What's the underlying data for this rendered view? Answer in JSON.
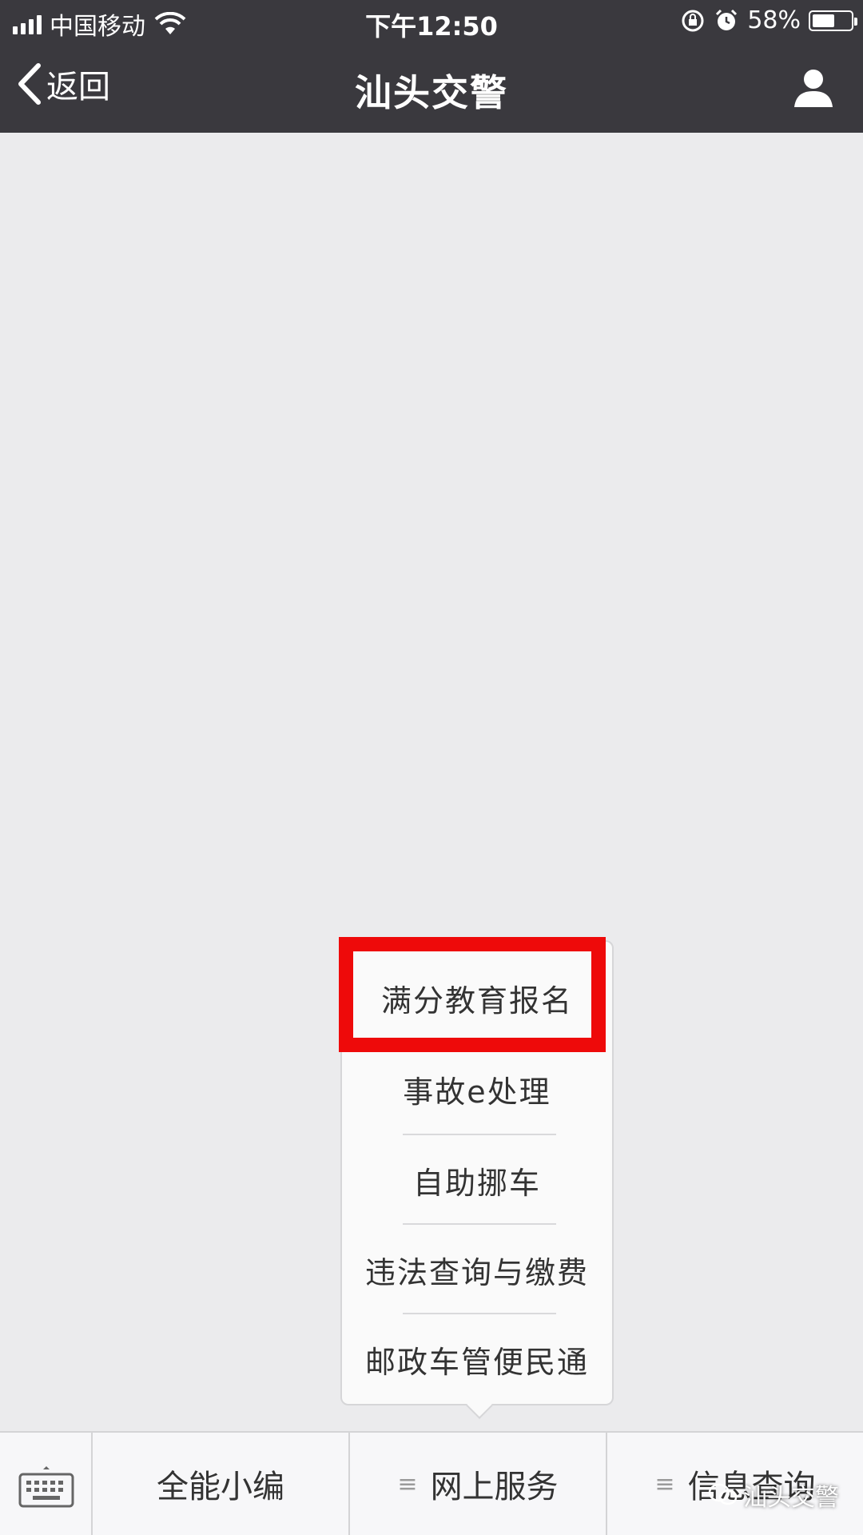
{
  "status_bar": {
    "carrier": "中国移动",
    "time": "下午12:50",
    "battery_percent": "58%",
    "battery_level": 0.58
  },
  "nav": {
    "back_label": "返回",
    "title": "汕头交警"
  },
  "popup_menu": {
    "items": [
      {
        "label": "满分教育报名",
        "highlighted": true
      },
      {
        "label": "事故e处理"
      },
      {
        "label": "自助挪车"
      },
      {
        "label": "违法查询与缴费"
      },
      {
        "label": "邮政车管便民通"
      }
    ]
  },
  "bottom_menu": {
    "tabs": [
      {
        "label": "全能小编"
      },
      {
        "label": "网上服务",
        "icon": "≡"
      },
      {
        "label": "信息查询",
        "icon": "≡"
      }
    ]
  },
  "watermark": {
    "text": "汕头交警"
  },
  "colors": {
    "topbar": "#3a393e",
    "background": "#ebebed",
    "highlight": "#ee0a0a"
  },
  "icons": [
    "signal-icon",
    "wifi-icon",
    "rotation-lock-icon",
    "alarm-icon",
    "battery-icon",
    "back-chevron-icon",
    "profile-icon",
    "keyboard-icon",
    "menu-icon",
    "wechat-icon"
  ]
}
